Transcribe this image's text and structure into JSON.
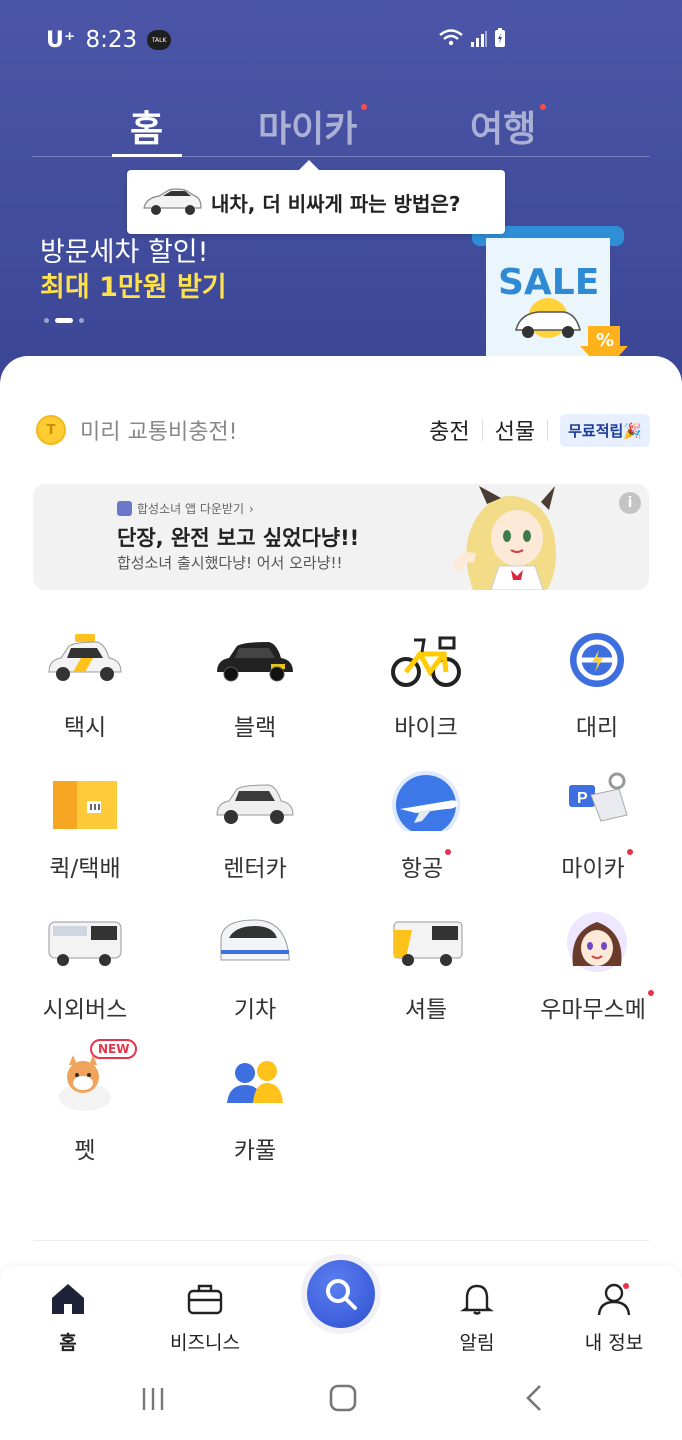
{
  "status_bar": {
    "carrier": "U⁺",
    "time": "8:23",
    "talk_badge": "TALK"
  },
  "top_tabs": [
    {
      "label": "홈",
      "active": true,
      "new_dot": false
    },
    {
      "label": "마이카",
      "active": false,
      "new_dot": true
    },
    {
      "label": "여행",
      "active": false,
      "new_dot": true
    }
  ],
  "tooltip": {
    "text": "내차, 더 비싸게 파는 방법은?"
  },
  "hero_banner": {
    "line1": "방문세차 할인!",
    "line2": "최대 1만원 받기",
    "sale_badge": "SALE",
    "percent": "%"
  },
  "charge_row": {
    "coin_letter": "T",
    "label": "미리 교통비충전!",
    "charge": "충전",
    "gift": "선물",
    "free_tag": "무료적립🎉"
  },
  "ad": {
    "source": "합성소녀 앱 다운받기",
    "source_arrow": "›",
    "headline": "단장, 완전 보고 싶었다냥!!",
    "sub": "합성소녀 출시했다냥! 어서 오라냥!!",
    "info": "i"
  },
  "services": [
    {
      "label": "택시",
      "icon": "taxi-icon",
      "dot": false
    },
    {
      "label": "블랙",
      "icon": "black-car-icon",
      "dot": false
    },
    {
      "label": "바이크",
      "icon": "bike-icon",
      "dot": false
    },
    {
      "label": "대리",
      "icon": "steering-wheel-icon",
      "dot": false
    },
    {
      "label": "퀵/택배",
      "icon": "box-icon",
      "dot": false
    },
    {
      "label": "렌터카",
      "icon": "rental-car-icon",
      "dot": false
    },
    {
      "label": "항공",
      "icon": "airplane-icon",
      "dot": true
    },
    {
      "label": "마이카",
      "icon": "parking-key-icon",
      "dot": true
    },
    {
      "label": "시외버스",
      "icon": "bus-icon",
      "dot": false
    },
    {
      "label": "기차",
      "icon": "train-icon",
      "dot": false
    },
    {
      "label": "셔틀",
      "icon": "shuttle-icon",
      "dot": false
    },
    {
      "label": "우마무스메",
      "icon": "character-avatar-icon",
      "dot": true
    },
    {
      "label": "펫",
      "icon": "dog-icon",
      "dot": false,
      "badge": "NEW"
    },
    {
      "label": "카풀",
      "icon": "carpool-icon",
      "dot": false
    }
  ],
  "bottom_nav": [
    {
      "label": "홈",
      "icon": "home-icon",
      "active": true
    },
    {
      "label": "비즈니스",
      "icon": "briefcase-icon",
      "active": false
    },
    {
      "label": "",
      "icon": "search-icon",
      "active": false
    },
    {
      "label": "알림",
      "icon": "bell-icon",
      "active": false
    },
    {
      "label": "내 정보",
      "icon": "user-icon",
      "active": false
    }
  ],
  "colors": {
    "hero_bg": "#3f4a9c",
    "accent_yellow": "#ffe14b",
    "search_blue": "#3556d6",
    "dot_red": "#e8344b"
  }
}
